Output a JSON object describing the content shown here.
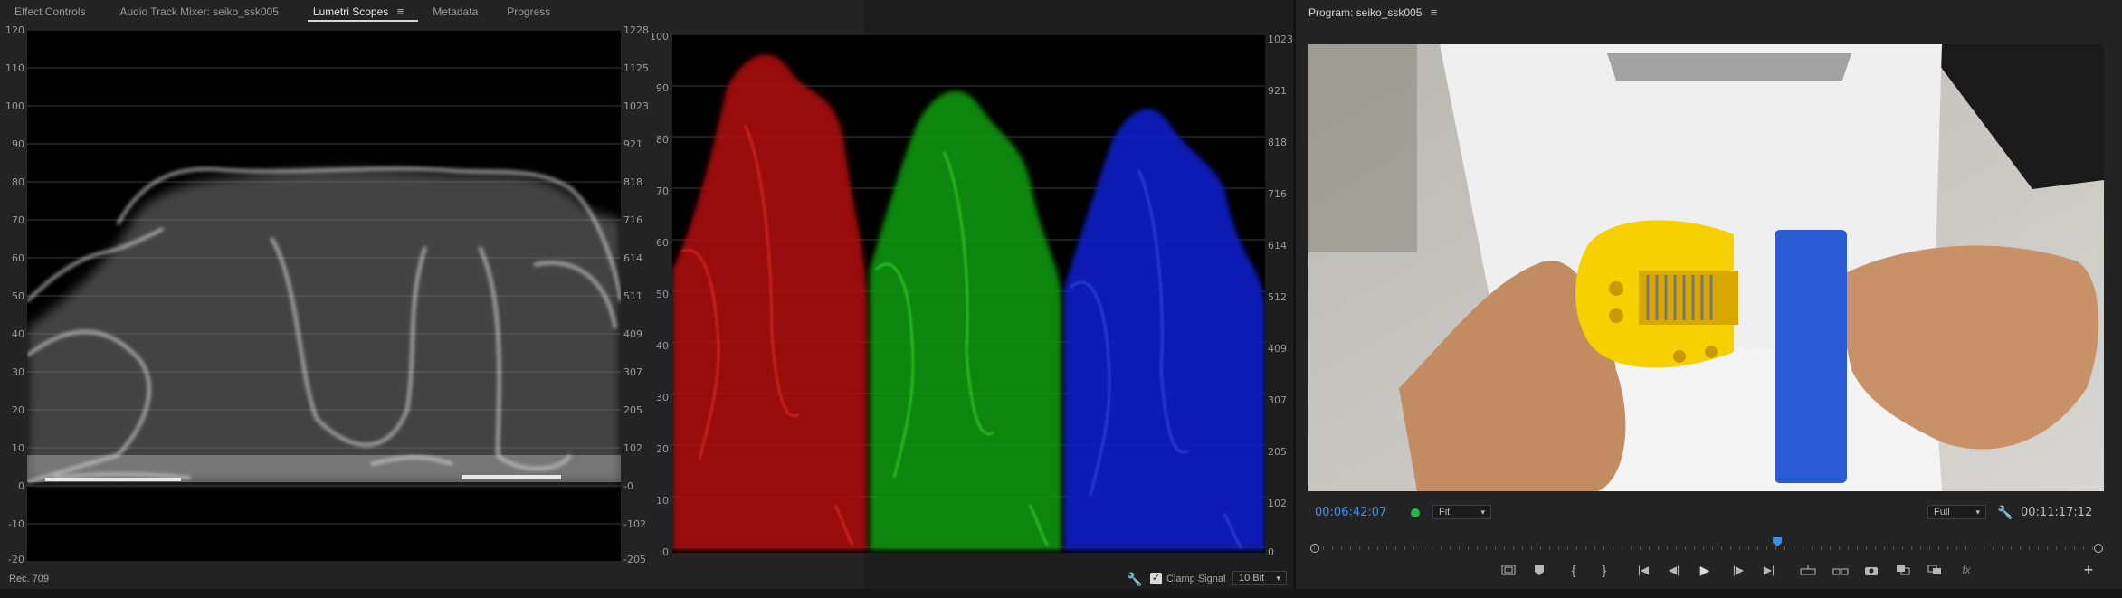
{
  "left_panel": {
    "tabs": [
      {
        "label": "Effect Controls",
        "active": false
      },
      {
        "label": "Audio Track Mixer: seiko_ssk005",
        "active": false
      },
      {
        "label": "Lumetri Scopes",
        "active": true
      },
      {
        "label": "Metadata",
        "active": false
      },
      {
        "label": "Progress",
        "active": false
      }
    ],
    "waveform_left_ticks": [
      "120",
      "110",
      "100",
      "90",
      "80",
      "70",
      "60",
      "50",
      "40",
      "30",
      "20",
      "10",
      "0",
      "-10",
      "-20"
    ],
    "waveform_right_ticks": [
      "1228",
      "1125",
      "1023",
      "921",
      "818",
      "716",
      "614",
      "511",
      "409",
      "307",
      "205",
      "102",
      "-0",
      "-102",
      "-205"
    ],
    "parade_left_ticks": [
      "100",
      "90",
      "80",
      "70",
      "60",
      "50",
      "40",
      "30",
      "20",
      "10",
      "0"
    ],
    "parade_right_ticks": [
      "1023",
      "921",
      "818",
      "716",
      "614",
      "512",
      "409",
      "307",
      "205",
      "102",
      "0"
    ],
    "status_left": "Rec. 709",
    "clamp_signal_label": "Clamp Signal",
    "clamp_signal_checked": true,
    "bit_depth": "10 Bit"
  },
  "program_monitor": {
    "title": "Program: seiko_ssk005",
    "current_timecode": "00:06:42:07",
    "zoom": "Fit",
    "resolution": "Full",
    "duration_timecode": "00:11:17:12",
    "playhead_fraction": 0.59,
    "colors": {
      "accent": "#3d8ee6",
      "status_dot": "#2fb34a"
    }
  },
  "icons": {
    "wrench": "wrench-icon",
    "hamburger": "panel-menu-icon"
  }
}
